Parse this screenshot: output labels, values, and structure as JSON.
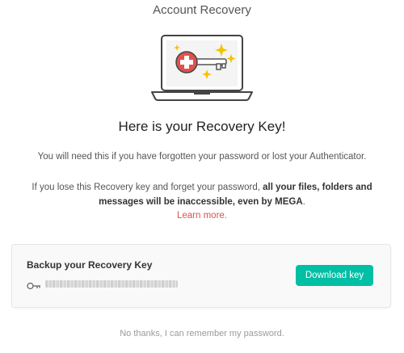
{
  "dialog": {
    "title": "Account Recovery",
    "heading": "Here is your Recovery Key!",
    "paragraph1": "You will need this if you have forgotten your password or lost your Authenticator.",
    "paragraph2_prefix": "If you lose this Recovery key and forget your password, ",
    "paragraph2_bold": "all your files, folders and messages will be inaccessible, even by MEGA",
    "paragraph2_suffix": ".",
    "learn_more": "Learn more."
  },
  "backup": {
    "title": "Backup your Recovery Key",
    "key_value": "••••••••••••••••••••••••••••",
    "key_icon": "key-icon",
    "download_label": "Download key"
  },
  "footer": {
    "dismiss": "No thanks, I can remember my password."
  },
  "colors": {
    "accent": "#00bfa5",
    "link": "#d9534f",
    "brand_red": "#e0524c",
    "sparkle": "#f2c200"
  },
  "icons": [
    "laptop-illustration",
    "recovery-key-icon",
    "sparkle-icon",
    "key-icon"
  ]
}
